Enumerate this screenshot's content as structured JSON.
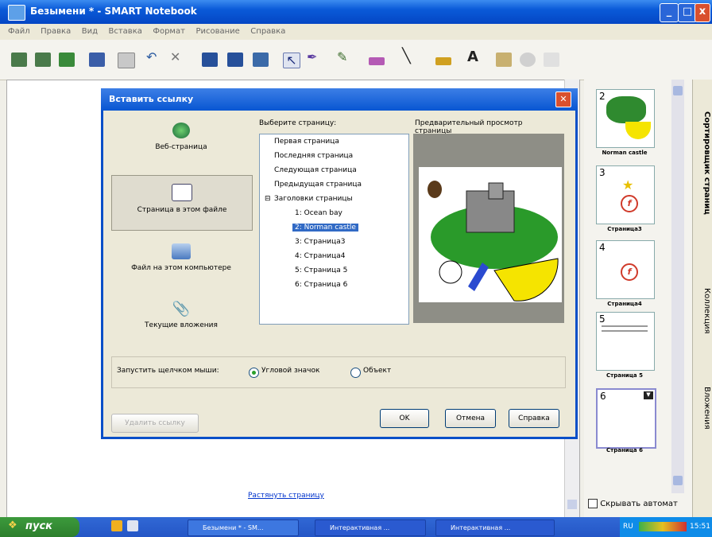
{
  "window": {
    "title": "Безымени * - SMART Notebook",
    "min": "_",
    "max": "□",
    "close": "x"
  },
  "menu": [
    "Файл",
    "Правка",
    "Вид",
    "Вставка",
    "Формат",
    "Рисование",
    "Справка"
  ],
  "canvas": {
    "stretch_link": "Растянуть страницу"
  },
  "side_panel": {
    "thumbs": [
      {
        "num": "2",
        "label": "Norman castle"
      },
      {
        "num": "3",
        "label": "Страница3"
      },
      {
        "num": "4",
        "label": "Страница4"
      },
      {
        "num": "5",
        "label": "Страница 5"
      },
      {
        "num": "6",
        "label": "Страница 6"
      }
    ],
    "hide_auto": "Скрывать автомат",
    "tabs": [
      "Сортировщик страниц",
      "Коллекция",
      "Вложения"
    ]
  },
  "dialog": {
    "title": "Вставить ссылку",
    "link_types": [
      {
        "label": "Веб-страница"
      },
      {
        "label": "Страница в этом файле"
      },
      {
        "label": "Файл на этом компьютере"
      },
      {
        "label": "Текущие вложения"
      }
    ],
    "choose_page_label": "Выберите страницу:",
    "preview_label": "Предварительный просмотр страницы",
    "tree": {
      "items": [
        "Первая страница",
        "Последняя страница",
        "Следующая страница",
        "Предыдущая страница"
      ],
      "group": "Заголовки страницы",
      "expander": "⊟",
      "children": [
        "1: Ocean bay",
        "2: Norman castle",
        "3: Страница3",
        "4: Страница4",
        "5: Страница 5",
        "6: Страница 6"
      ],
      "selected_index": 1
    },
    "click_label": "Запустить щелчком мыши:",
    "radio_corner": "Угловой значок",
    "radio_object": "Объект",
    "delete_link": "Удалить ссылку",
    "ok": "OK",
    "cancel": "Отмена",
    "help": "Справка"
  },
  "taskbar": {
    "start": "пуск",
    "tasks": [
      "Безымени * - SM...",
      "Интерактивная ...",
      "Интерактивная ..."
    ],
    "lang": "RU",
    "time": "15:51"
  },
  "colors": {
    "title_blue": "#0a5ad8",
    "selection": "#316ac5",
    "tree_border": "#7f9db9"
  }
}
